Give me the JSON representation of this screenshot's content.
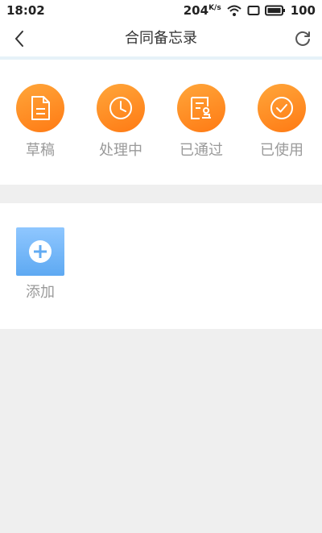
{
  "status_bar": {
    "time": "18:02",
    "speed": "204",
    "speed_unit": "K/s",
    "battery": "100"
  },
  "header": {
    "title": "合同备忘录"
  },
  "statuses": [
    {
      "label": "草稿",
      "icon": "draft-document-icon"
    },
    {
      "label": "处理中",
      "icon": "clock-icon"
    },
    {
      "label": "已通过",
      "icon": "approved-stamp-icon"
    },
    {
      "label": "已使用",
      "icon": "check-circle-icon"
    }
  ],
  "actions": {
    "add_label": "添加"
  },
  "colors": {
    "accent_orange": "#ff8a1f",
    "add_blue": "#6cb2f7",
    "label_gray": "#9a9a9a",
    "background": "#efefef"
  }
}
